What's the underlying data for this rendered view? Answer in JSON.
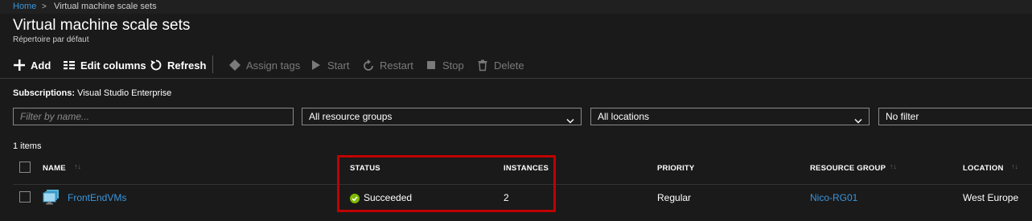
{
  "breadcrumb": {
    "home": "Home",
    "separator": ">",
    "current": "Virtual machine scale sets"
  },
  "header": {
    "title": "Virtual machine scale sets",
    "subtitle": "Répertoire par défaut"
  },
  "toolbar": {
    "add": "Add",
    "edit_columns": "Edit columns",
    "refresh": "Refresh",
    "assign_tags": "Assign tags",
    "start": "Start",
    "restart": "Restart",
    "stop": "Stop",
    "delete": "Delete"
  },
  "subscriptions": {
    "label": "Subscriptions:",
    "value": "Visual Studio Enterprise"
  },
  "filters": {
    "name_placeholder": "Filter by name...",
    "resource_groups": "All resource groups",
    "locations": "All locations",
    "filter": "No filter"
  },
  "items_count": "1 items",
  "columns": {
    "name": "NAME",
    "status": "STATUS",
    "instances": "INSTANCES",
    "priority": "PRIORITY",
    "resource_group": "RESOURCE GROUP",
    "location": "LOCATION"
  },
  "rows": [
    {
      "name": "FrontEndVMs",
      "status": "Succeeded",
      "instances": "2",
      "priority": "Regular",
      "resource_group": "Nico-RG01",
      "location": "West Europe"
    }
  ],
  "colors": {
    "accent": "#3a96dd",
    "success": "#7fba00",
    "highlight": "#c00000",
    "background": "#1a1a1a"
  },
  "icons": {
    "add": "plus-icon",
    "edit_columns": "columns-icon",
    "refresh": "refresh-icon",
    "assign_tags": "tag-icon",
    "start": "play-icon",
    "restart": "restart-icon",
    "stop": "stop-icon",
    "delete": "trash-icon",
    "status": "success-check-icon",
    "vmss": "vm-scale-set-icon"
  }
}
